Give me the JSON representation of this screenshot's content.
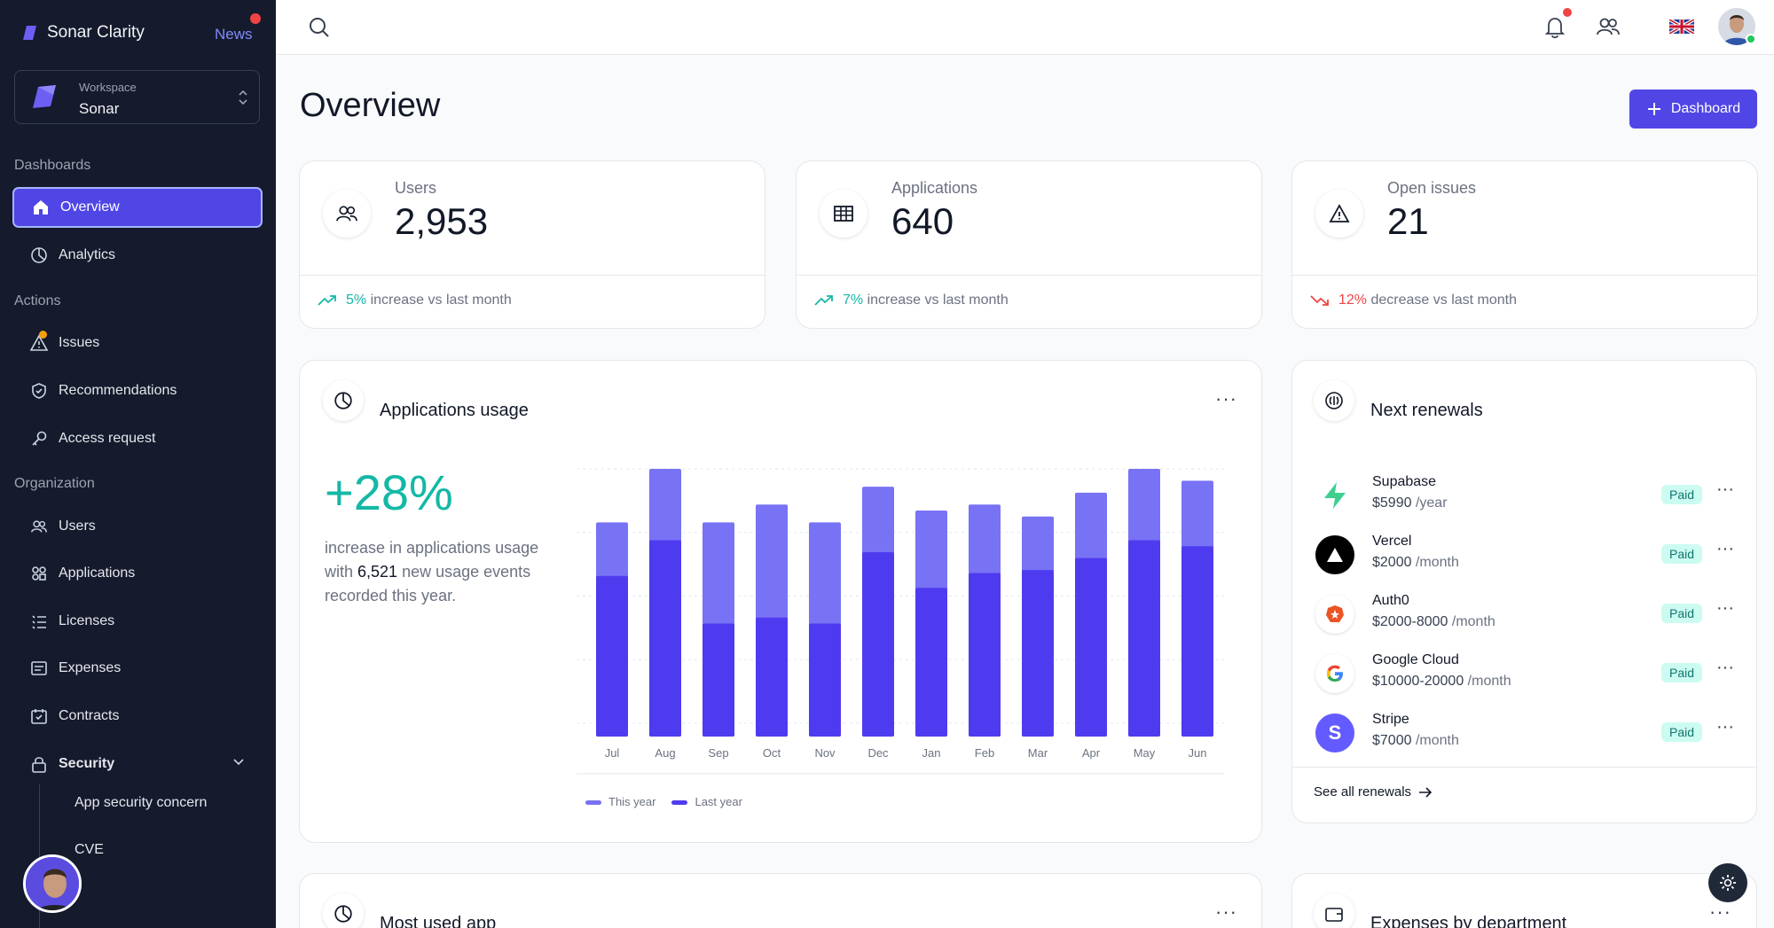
{
  "sidebar": {
    "brand": "Sonar Clarity",
    "news": "News",
    "workspace": {
      "label": "Workspace",
      "value": "Sonar"
    },
    "sections": {
      "dashboards": "Dashboards",
      "actions": "Actions",
      "organization": "Organization"
    },
    "items": {
      "overview": "Overview",
      "analytics": "Analytics",
      "issues": "Issues",
      "recommendations": "Recommendations",
      "access_request": "Access request",
      "users": "Users",
      "applications": "Applications",
      "licenses": "Licenses",
      "expenses": "Expenses",
      "contracts": "Contracts",
      "security": "Security"
    },
    "security_sub": {
      "app_security": "App security concern",
      "cve": "CVE"
    }
  },
  "header": {
    "title": "Overview",
    "dashboard_button": "Dashboard"
  },
  "stats": [
    {
      "label": "Users",
      "value": "2,953",
      "change": "5%",
      "trend_text": "increase vs last month",
      "trend": "up"
    },
    {
      "label": "Applications",
      "value": "640",
      "change": "7%",
      "trend_text": "increase vs last month",
      "trend": "up"
    },
    {
      "label": "Open issues",
      "value": "21",
      "change": "12%",
      "trend_text": "decrease vs last month",
      "trend": "down"
    }
  ],
  "usage": {
    "title": "Applications usage",
    "big_value": "+28%",
    "desc_pre": "increase in applications usage with ",
    "desc_num": "6,521",
    "desc_post": " new usage events recorded this year.",
    "legend": {
      "this_year": "This year",
      "last_year": "Last year"
    }
  },
  "chart_data": {
    "type": "bar",
    "stacked": "overlay",
    "categories": [
      "Jul",
      "Aug",
      "Sep",
      "Oct",
      "Nov",
      "Dec",
      "Jan",
      "Feb",
      "Mar",
      "Apr",
      "May",
      "Jun"
    ],
    "series": [
      {
        "name": "This year",
        "color": "#7872f5",
        "values": [
          72,
          90,
          72,
          78,
          72,
          84,
          76,
          78,
          74,
          82,
          90,
          86
        ]
      },
      {
        "name": "Last year",
        "color": "#4f3bef",
        "values": [
          54,
          66,
          38,
          40,
          38,
          62,
          50,
          55,
          56,
          60,
          66,
          64
        ]
      }
    ],
    "ylim": [
      0,
      90
    ],
    "grid": true,
    "legend_position": "bottom-left"
  },
  "renewals": {
    "title": "Next renewals",
    "items": [
      {
        "name": "Supabase",
        "price": "$5990",
        "period": "/year",
        "status": "Paid",
        "icon": "supabase-logo"
      },
      {
        "name": "Vercel",
        "price": "$2000",
        "period": "/month",
        "status": "Paid",
        "icon": "vercel-logo"
      },
      {
        "name": "Auth0",
        "price": "$2000-8000",
        "period": "/month",
        "status": "Paid",
        "icon": "auth0-logo"
      },
      {
        "name": "Google Cloud",
        "price": "$10000-20000",
        "period": "/month",
        "status": "Paid",
        "icon": "google-logo"
      },
      {
        "name": "Stripe",
        "price": "$7000",
        "period": "/month",
        "status": "Paid",
        "icon": "stripe-logo"
      }
    ],
    "see_all": "See all renewals"
  },
  "bottom": {
    "left_title": "Most used app",
    "right_title": "Expenses by department"
  },
  "colors": {
    "accent": "#5046e5",
    "sidebar_bg": "#151a2d",
    "positive": "#14b8a6",
    "negative": "#ef4444"
  }
}
